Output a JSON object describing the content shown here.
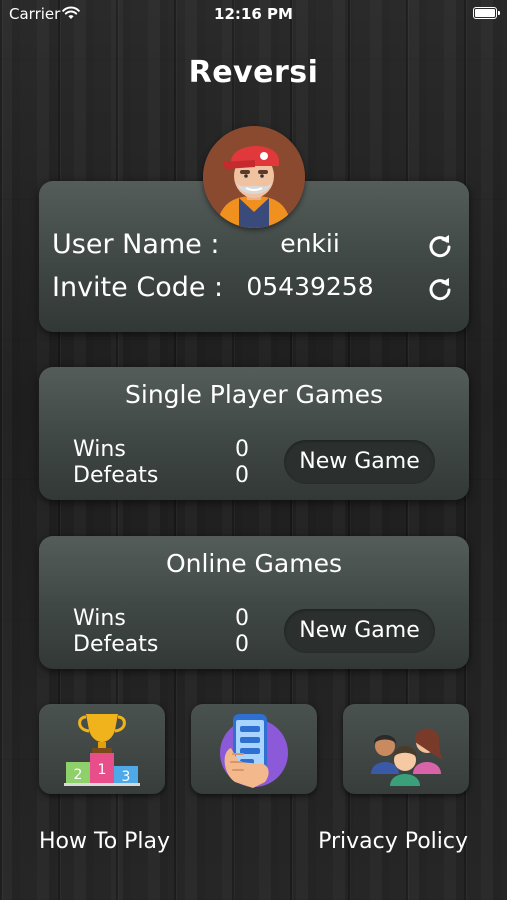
{
  "status_bar": {
    "carrier": "Carrier",
    "time": "12:16 PM"
  },
  "app": {
    "title": "Reversi"
  },
  "profile": {
    "user_name_label": "User Name :",
    "user_name": "enkii",
    "invite_code_label": "Invite Code :",
    "invite_code": "05439258"
  },
  "single_player": {
    "title": "Single Player Games",
    "wins_label": "Wins",
    "wins": "0",
    "defeats_label": "Defeats",
    "defeats": "0",
    "new_game_label": "New Game"
  },
  "online": {
    "title": "Online Games",
    "wins_label": "Wins",
    "wins": "0",
    "defeats_label": "Defeats",
    "defeats": "0",
    "new_game_label": "New Game"
  },
  "leaderboard": {
    "ranks": [
      "2",
      "1",
      "3"
    ]
  },
  "footer": {
    "how_to_play": "How To Play",
    "privacy_policy": "Privacy Policy"
  },
  "icons": {
    "wifi": "wifi-icon",
    "battery": "battery-icon",
    "refresh": "refresh-icon",
    "leaderboard": "podium-trophy-icon",
    "phone": "phone-in-hand-icon",
    "friends": "group-people-icon"
  },
  "colors": {
    "card": "#4a524f",
    "button": "#2b302f",
    "cap": "#e23a3a",
    "podium_pink": "#e84f8a"
  }
}
